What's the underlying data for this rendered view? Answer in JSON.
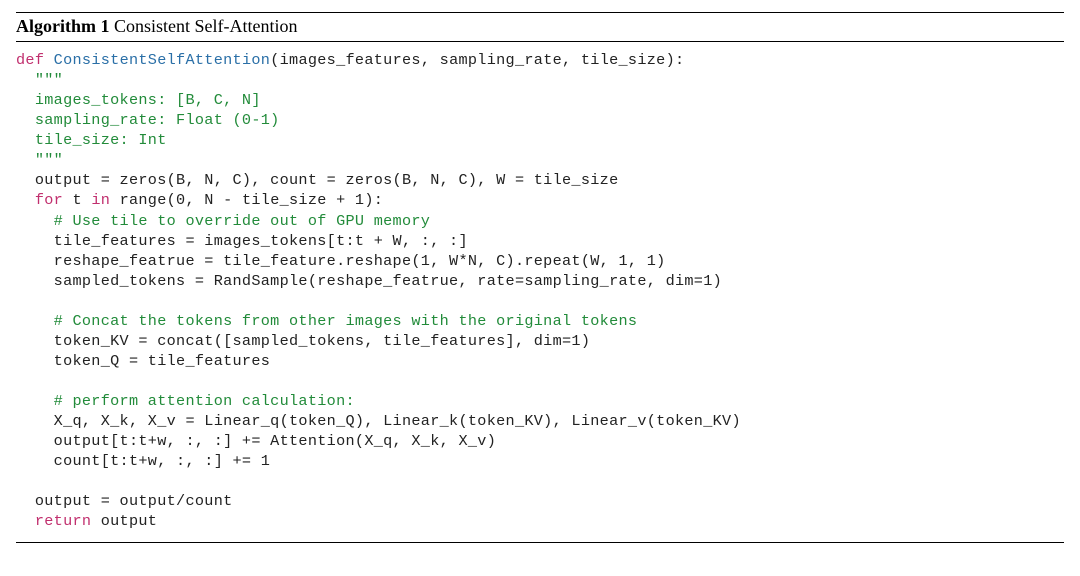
{
  "algorithm": {
    "label": "Algorithm 1",
    "title": "Consistent Self-Attention"
  },
  "code": {
    "kw_def": "def",
    "fn_name": "ConsistentSelfAttention",
    "sig_rest": "(images_features, sampling_rate, tile_size):",
    "doc_open": "  \"\"\"",
    "doc_l1": "  images_tokens: [B, C, N]",
    "doc_l2": "  sampling_rate: Float (0-1)",
    "doc_l3": "  tile_size: Int",
    "doc_close": "  \"\"\"",
    "l_init": "  output = zeros(B, N, C), count = zeros(B, N, C), W = tile_size",
    "kw_for": "for",
    "for_var": " t ",
    "kw_in": "in",
    "for_range": " range(0, N - tile_size + 1):",
    "c_tile": "    # Use tile to override out of GPU memory",
    "l_tilefeat": "    tile_features = images_tokens[t:t + W, :, :]",
    "l_reshape": "    reshape_featrue = tile_feature.reshape(1, W*N, C).repeat(W, 1, 1)",
    "l_sampled": "    sampled_tokens = RandSample(reshape_featrue, rate=sampling_rate, dim=1)",
    "blank": " ",
    "c_concat": "    # Concat the tokens from other images with the original tokens",
    "l_kv": "    token_KV = concat([sampled_tokens, tile_features], dim=1)",
    "l_q": "    token_Q = tile_features",
    "c_attn": "    # perform attention calculation:",
    "l_lin": "    X_q, X_k, X_v = Linear_q(token_Q), Linear_k(token_KV), Linear_v(token_KV)",
    "l_out": "    output[t:t+w, :, :] += Attention(X_q, X_k, X_v)",
    "l_cnt": "    count[t:t+w, :, :] += 1",
    "l_div": "  output = output/count",
    "kw_return": "return",
    "ret_val": " output"
  }
}
